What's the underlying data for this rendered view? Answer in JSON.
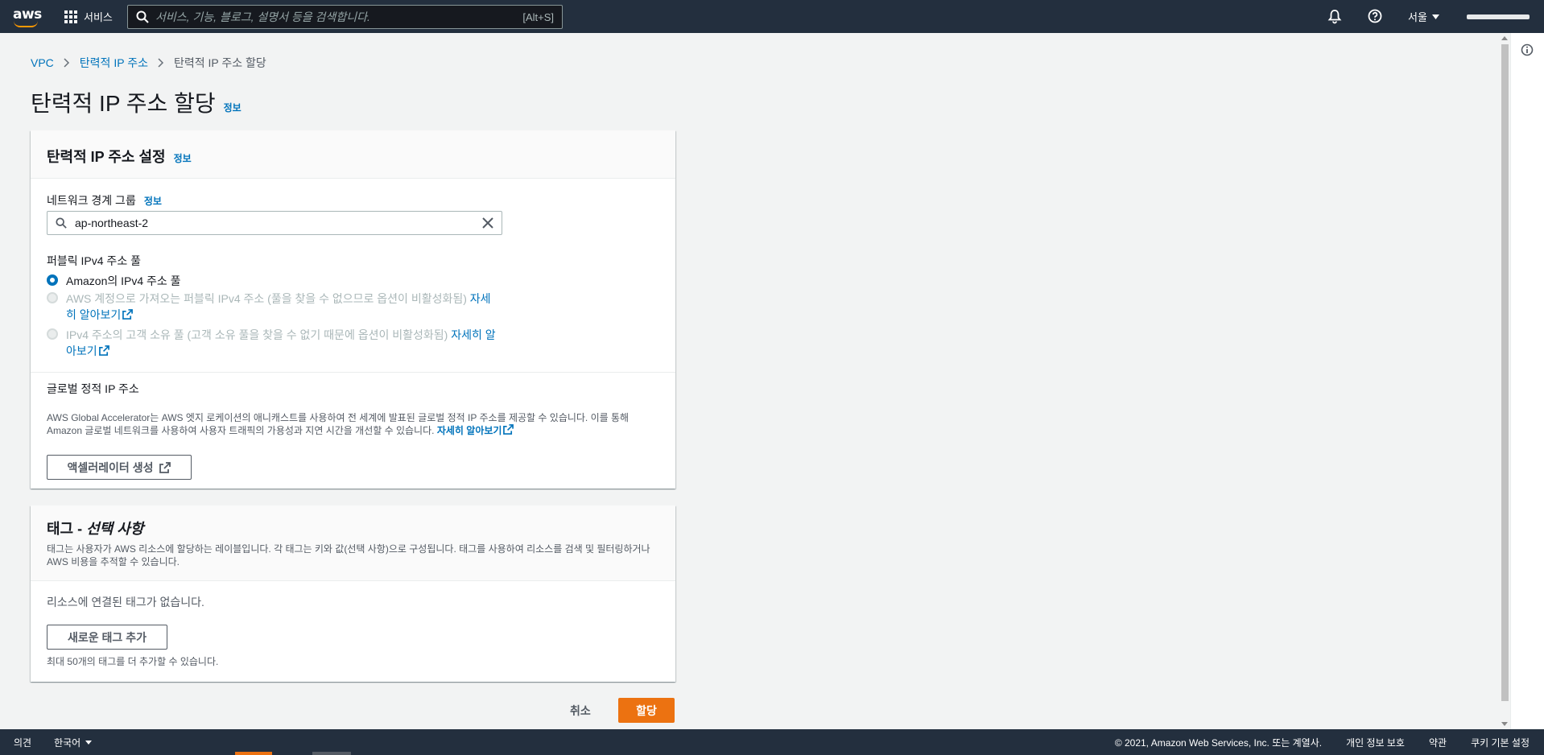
{
  "topnav": {
    "logo_text": "aws",
    "services_label": "서비스",
    "search_placeholder": "서비스, 기능, 블로그, 설명서 등을 검색합니다.",
    "search_shortcut": "[Alt+S]",
    "region": "서울"
  },
  "breadcrumb": {
    "items": [
      "VPC",
      "탄력적 IP 주소"
    ],
    "current": "탄력적 IP 주소 할당"
  },
  "page": {
    "title": "탄력적 IP 주소 할당",
    "info": "정보"
  },
  "settings": {
    "title": "탄력적 IP 주소 설정",
    "info": "정보",
    "nbg_label": "네트워크 경계 그룹",
    "nbg_info": "정보",
    "nbg_value": "ap-northeast-2",
    "pool_label": "퍼블릭 IPv4 주소 풀",
    "options": [
      {
        "text": "Amazon의 IPv4 주소 풀",
        "selected": true,
        "disabled": false
      },
      {
        "text": "AWS 계정으로 가져오는 퍼블릭 IPv4 주소 (풀을 찾을 수 없으므로 옵션이 비활성화됨)",
        "link": "자세히 알아보기",
        "selected": false,
        "disabled": true
      },
      {
        "text": "IPv4 주소의 고객 소유 풀 (고객 소유 풀을 찾을 수 없기 때문에 옵션이 비활성화됨)",
        "link": "자세히 알아보기",
        "selected": false,
        "disabled": true
      }
    ],
    "gsi_label": "글로벌 정적 IP 주소",
    "gsi_desc": "AWS Global Accelerator는 AWS 엣지 로케이션의 애니캐스트를 사용하여 전 세계에 발표된 글로벌 정적 IP 주소를 제공할 수 있습니다. 이를 통해 Amazon 글로벌 네트워크를 사용하여 사용자 트래픽의 가용성과 지연 시간을 개선할 수 있습니다.",
    "gsi_link": "자세히 알아보기",
    "accel_button": "액셀러레이터 생성"
  },
  "tags": {
    "title_prefix": "태그 - ",
    "title_optional": "선택 사항",
    "desc": "태그는 사용자가 AWS 리소스에 할당하는 레이블입니다. 각 태그는 키와 값(선택 사항)으로 구성됩니다. 태그를 사용하여 리소스를 검색 및 필터링하거나 AWS 비용을 추적할 수 있습니다.",
    "empty": "리소스에 연결된 태그가 없습니다.",
    "add_button": "새로운 태그 추가",
    "limit": "최대 50개의 태그를 더 추가할 수 있습니다."
  },
  "actions": {
    "cancel": "취소",
    "submit": "할당"
  },
  "footer": {
    "feedback": "의견",
    "language": "한국어",
    "copyright": "© 2021, Amazon Web Services, Inc. 또는 계열사.",
    "privacy": "개인 정보 보호",
    "terms": "약관",
    "cookies": "쿠키 기본 설정"
  },
  "colors": {
    "nav_bg": "#232f3e",
    "link": "#0073bb",
    "primary": "#ec7211",
    "accent": "#ff9900"
  },
  "icons": {
    "services": "grid-icon",
    "search": "search-icon",
    "notifications": "bell-icon",
    "help": "question-circle-icon",
    "region_caret": "caret-down-icon",
    "clear": "close-icon",
    "external": "external-link-icon",
    "info_panel": "info-circle-icon"
  }
}
